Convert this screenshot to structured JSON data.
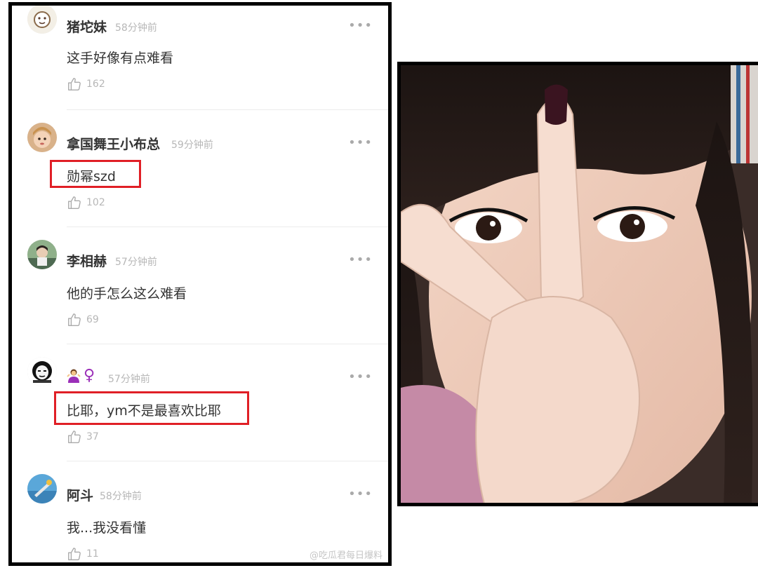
{
  "comments": [
    {
      "username": "猪坨妹",
      "time": "58分钟前",
      "text": "这手好像有点难看",
      "likes": "162"
    },
    {
      "username": "拿国舞王小布总",
      "time": "59分钟前",
      "text": "勋幂szd",
      "likes": "102"
    },
    {
      "username": "李相赫",
      "time": "57分钟前",
      "text": "他的手怎么这么难看",
      "likes": "69"
    },
    {
      "username": "🤷‍♀️♀️",
      "time": "57分钟前",
      "text": "比耶，ym不是最喜欢比耶",
      "likes": "37"
    },
    {
      "username": "阿斗",
      "time": "58分钟前",
      "text": "我...我没看懂",
      "likes": "11"
    }
  ],
  "more_label": "•••",
  "watermark": "@吃瓜君每日爆料",
  "colors": {
    "highlight": "#e01f26",
    "meta_text": "#b7b7b7",
    "venus": "#9b2fb8"
  }
}
